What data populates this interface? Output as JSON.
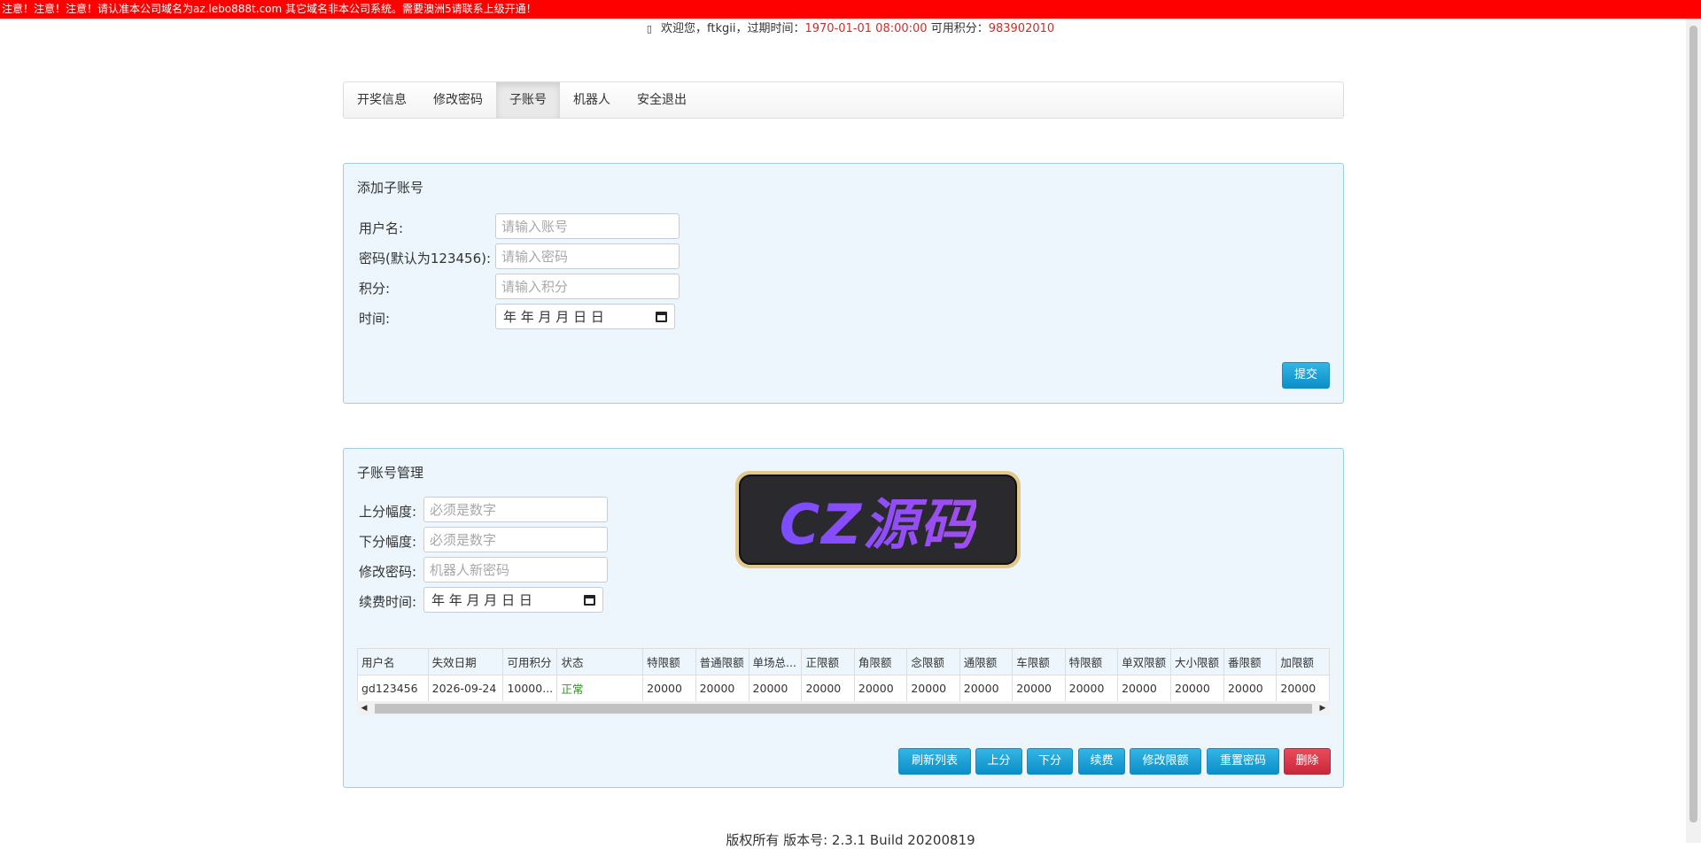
{
  "notice": "注意！注意！注意！请认准本公司域名为az.lebo888t.com 其它域名非本公司系统。需要澳洲5请联系上级开通！",
  "welcome": {
    "prefix": "欢迎您，ftkgii，过期时间：",
    "expire": "1970-01-01 08:00:00",
    "points_label": "可用积分：",
    "points": "983902010"
  },
  "nav": [
    "开奖信息",
    "修改密码",
    "子账号",
    "机器人",
    "安全退出"
  ],
  "add_panel": {
    "title": "添加子账号",
    "username_label": "用户名:",
    "username_placeholder": "请输入账号",
    "password_label": "密码(默认为123456):",
    "password_placeholder": "请输入密码",
    "points_label": "积分:",
    "points_placeholder": "请输入积分",
    "time_label": "时间:",
    "date_placeholder": "年 年 月 月 日 日",
    "submit": "提交"
  },
  "manage_panel": {
    "title": "子账号管理",
    "up_label": "上分幅度:",
    "up_placeholder": "必须是数字",
    "down_label": "下分幅度:",
    "down_placeholder": "必须是数字",
    "pwd_label": "修改密码:",
    "pwd_placeholder": "机器人新密码",
    "renew_label": "续费时间:",
    "date_placeholder": "年 年 月 月 日 日",
    "table": {
      "headers": [
        "用户名",
        "失效日期",
        "可用积分",
        "状态",
        "特限额",
        "普通限额",
        "单场总...",
        "正限额",
        "角限额",
        "念限额",
        "通限额",
        "车限额",
        "特限额",
        "单双限额",
        "大小限额",
        "番限额",
        "加限额"
      ],
      "rows": [
        [
          "gd123456",
          "2026-09-24",
          "10000...",
          "正常",
          "20000",
          "20000",
          "20000",
          "20000",
          "20000",
          "20000",
          "20000",
          "20000",
          "20000",
          "20000",
          "20000",
          "20000",
          "20000"
        ]
      ]
    },
    "buttons": {
      "refresh": "刷新列表",
      "up": "上分",
      "down": "下分",
      "renew": "续费",
      "limit": "修改限额",
      "reset": "重置密码",
      "delete": "删除"
    }
  },
  "logo_text": "CZ源码",
  "footer": "版权所有 版本号: 2.3.1 Build 20200819",
  "colors": {
    "notice_bg": "#ff0000",
    "panel_bg": "#ecf6fc",
    "panel_border": "#9fcde6",
    "primary": "#1b9ad6",
    "danger": "#d9334a",
    "status_ok": "#3c8d2f"
  }
}
